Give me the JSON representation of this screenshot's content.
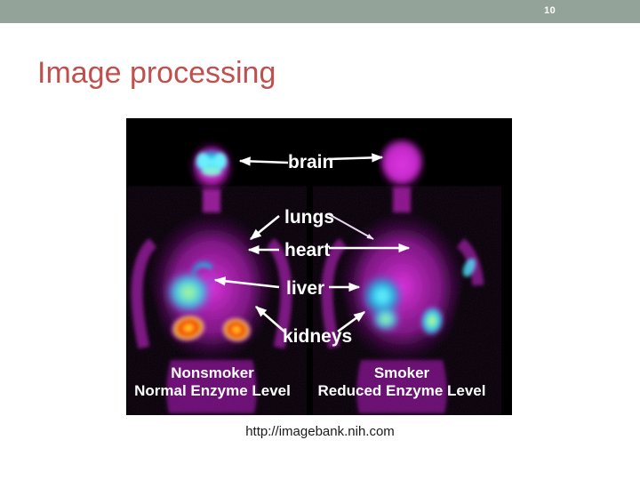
{
  "header": {
    "slide_number": "10",
    "bar_color": "#94a399"
  },
  "title": {
    "text": "Image processing",
    "color": "#c0504d"
  },
  "figure": {
    "alt_name": "pet-scan-smoker-vs-nonsmoker",
    "background_color": "#000000",
    "organ_labels": [
      {
        "text": "brain"
      },
      {
        "text": "lungs"
      },
      {
        "text": "heart"
      },
      {
        "text": "liver"
      },
      {
        "text": "kidneys"
      }
    ],
    "panels": [
      {
        "id": "left",
        "title": "Nonsmoker",
        "subtitle": "Normal Enzyme Level"
      },
      {
        "id": "right",
        "title": "Smoker",
        "subtitle": "Reduced Enzyme Level"
      }
    ]
  },
  "caption": {
    "text": "http://imagebank.nih.com"
  }
}
